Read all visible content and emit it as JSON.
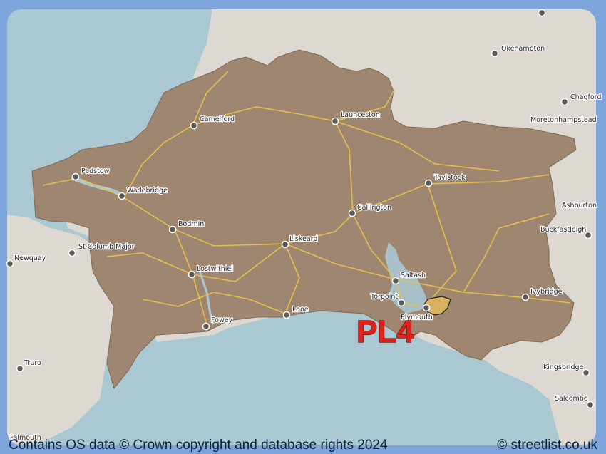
{
  "map": {
    "district_label": "PL4",
    "colors": {
      "frame": "#7fa6dc",
      "sea": "#a9c8d2",
      "land": "#ddd8d1",
      "region": "#9e8670",
      "roads": "#e9c24a",
      "highlight": "#d7b060"
    },
    "towns": [
      {
        "name": "Okehampton"
      },
      {
        "name": "Chagford"
      },
      {
        "name": "Moretonhampstead"
      },
      {
        "name": "Camelford"
      },
      {
        "name": "Launceston"
      },
      {
        "name": "Padstow"
      },
      {
        "name": "Wadebridge"
      },
      {
        "name": "Tavistock"
      },
      {
        "name": "Callington"
      },
      {
        "name": "Ashburton"
      },
      {
        "name": "Bodmin"
      },
      {
        "name": "Buckfastleigh"
      },
      {
        "name": "Liskeard"
      },
      {
        "name": "St Columb Major"
      },
      {
        "name": "Newquay"
      },
      {
        "name": "Saltash"
      },
      {
        "name": "Lostwithiel"
      },
      {
        "name": "Ivybridge"
      },
      {
        "name": "Torpoint"
      },
      {
        "name": "Plymouth"
      },
      {
        "name": "Looe"
      },
      {
        "name": "Fowey"
      },
      {
        "name": "Truro"
      },
      {
        "name": "Kingsbridge"
      },
      {
        "name": "Salcombe"
      },
      {
        "name": "Falmouth"
      }
    ]
  },
  "footer": {
    "attribution": "Contains OS data © Crown copyright and database rights 2024",
    "site": "© streetlist.co.uk"
  }
}
